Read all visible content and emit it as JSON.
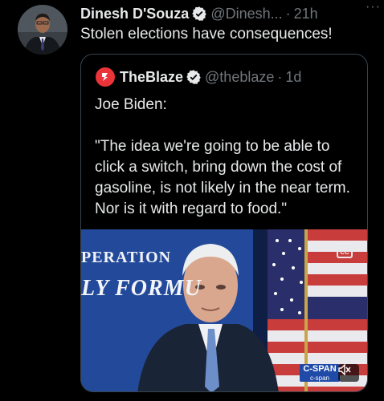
{
  "tweet": {
    "author_name": "Dinesh D'Souza",
    "handle": "@Dinesh...",
    "separator": "·",
    "time": "21h",
    "more": "···",
    "text": "Stolen elections have consequences!"
  },
  "quoted": {
    "author_name": "TheBlaze",
    "handle": "@theblaze",
    "separator": "·",
    "time": "1d",
    "text": "Joe Biden:\n\n\"The idea we're going to be able to click a switch, bring down the cost of gasoline, is not likely in the near term. Nor is it with regard to food.\""
  },
  "media": {
    "banner_line_1": "PERATION",
    "banner_line_2": "LY FORMU",
    "cc_label": "CC",
    "watermark_line_1": "C-SPAN",
    "watermark_line_2": "c-span",
    "colors": {
      "backdrop": "#1c3b82",
      "suit": "#1a2437",
      "tie": "#6d8fc9"
    }
  },
  "icons": {
    "verified": "verified-badge-icon",
    "blaze_logo": "theblaze-logo-icon",
    "mute": "muted-speaker-icon"
  },
  "colors": {
    "background": "#000000",
    "text": "#e7e9ea",
    "secondary": "#71767b",
    "verified": "#1d9bf0",
    "blaze": "#ea3439"
  }
}
